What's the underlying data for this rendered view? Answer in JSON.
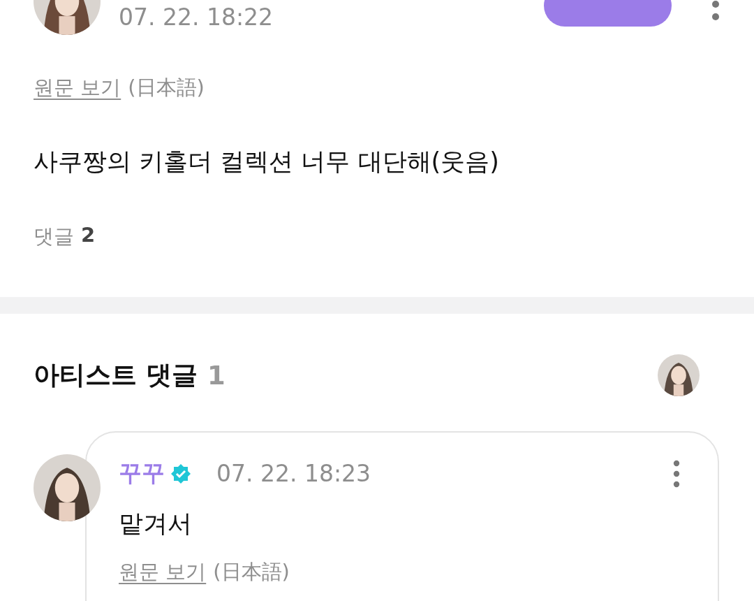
{
  "post": {
    "date": "07. 22. 18:22",
    "translation": {
      "link": "원문 보기",
      "language": "(日本語)"
    },
    "text": "사쿠짱의 키홀더 컬렉션 너무 대단해(웃음)",
    "comments": {
      "label": "댓글",
      "count": "2"
    }
  },
  "artist_comments": {
    "title": "아티스트 댓글",
    "count": "1",
    "items": [
      {
        "author": "꾸꾸",
        "verified": true,
        "date": "07. 22. 18:23",
        "text": "맡겨서",
        "translation": {
          "link": "원문 보기",
          "language": "(日本語)"
        }
      }
    ]
  }
}
